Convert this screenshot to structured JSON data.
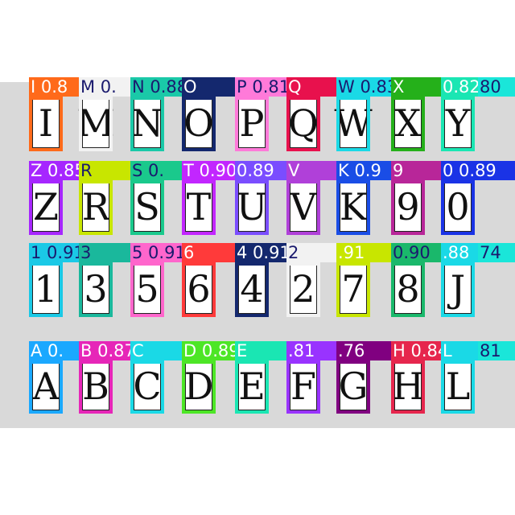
{
  "detections": [
    {
      "char": "I",
      "label": "I 0.8",
      "color": "#ff6a1a",
      "text_color": "#ffffff"
    },
    {
      "char": "M",
      "label": "M 0.",
      "color": "#f2f2f2",
      "text_color": "#1a1a6e"
    },
    {
      "char": "N",
      "label": "N 0.88",
      "color": "#1ac9a8",
      "text_color": "#1a1a6e"
    },
    {
      "char": "O",
      "label": "O",
      "color": "#14286e",
      "text_color": "#ffffff"
    },
    {
      "char": "P",
      "label": "P 0.81",
      "color": "#ff7ad9",
      "text_color": "#1a1a6e"
    },
    {
      "char": "Q",
      "label": "Q",
      "color": "#e8114d",
      "text_color": "#ffffff"
    },
    {
      "char": "W",
      "label": "W 0.83",
      "color": "#1ad9e6",
      "text_color": "#1a1a6e"
    },
    {
      "char": "X",
      "label": "X",
      "color": "#25b01a",
      "text_color": "#ffffff"
    },
    {
      "char": "Y",
      "label": "0.82",
      "color": "#1ae6b3",
      "text_color": "#ffffff"
    },
    {
      "char": "",
      "label": "80",
      "color": "#1ae6d9",
      "text_color": "#1a1a6e"
    },
    {
      "char": "Z",
      "label": "Z 0.85",
      "color": "#a626ff",
      "text_color": "#ffffff"
    },
    {
      "char": "R",
      "label": "R",
      "color": "#c8e600",
      "text_color": "#1a1a6e"
    },
    {
      "char": "S",
      "label": "S 0.",
      "color": "#1ac98c",
      "text_color": "#1a1a6e"
    },
    {
      "char": "T",
      "label": "T 0.90",
      "color": "#c226ff",
      "text_color": "#ffffff"
    },
    {
      "char": "U",
      "label": "0.89",
      "color": "#7a4dff",
      "text_color": "#ffffff"
    },
    {
      "char": "V",
      "label": "V",
      "color": "#b040d9",
      "text_color": "#ffffff"
    },
    {
      "char": "K",
      "label": "K 0.9",
      "color": "#1a4de6",
      "text_color": "#ffffff"
    },
    {
      "char": "9",
      "label": "9",
      "color": "#b82699",
      "text_color": "#ffffff"
    },
    {
      "char": "0",
      "label": "0 0.89",
      "color": "#1a33e6",
      "text_color": "#ffffff"
    },
    {
      "char": "1",
      "label": "1 0.91",
      "color": "#1ac9e6",
      "text_color": "#1a1a6e"
    },
    {
      "char": "3",
      "label": "3",
      "color": "#1ab89c",
      "text_color": "#1a1a6e"
    },
    {
      "char": "5",
      "label": "5 0.91",
      "color": "#ff66cc",
      "text_color": "#1a1a6e"
    },
    {
      "char": "6",
      "label": "6",
      "color": "#ff3a3a",
      "text_color": "#ffffff"
    },
    {
      "char": "4",
      "label": "4 0.91",
      "color": "#14286e",
      "text_color": "#ffffff"
    },
    {
      "char": "2",
      "label": "2",
      "color": "#f2f2f2",
      "text_color": "#1a1a6e"
    },
    {
      "char": "7",
      "label": ".91",
      "color": "#c8e600",
      "text_color": "#ffffff"
    },
    {
      "char": "8",
      "label": "0.90",
      "color": "#1ab86b",
      "text_color": "#1a1a6e"
    },
    {
      "char": "J",
      "label": ".88",
      "color": "#1ad9e6",
      "text_color": "#ffffff"
    },
    {
      "char": "",
      "label": "74",
      "color": "#1ae6d9",
      "text_color": "#1a1a6e"
    },
    {
      "char": "A",
      "label": "A 0.",
      "color": "#1aa8ff",
      "text_color": "#ffffff"
    },
    {
      "char": "B",
      "label": "B 0.87",
      "color": "#e626b8",
      "text_color": "#ffffff"
    },
    {
      "char": "C",
      "label": "C",
      "color": "#1ad9e6",
      "text_color": "#ffffff"
    },
    {
      "char": "D",
      "label": "D 0.89",
      "color": "#4de626",
      "text_color": "#ffffff"
    },
    {
      "char": "E",
      "label": "E",
      "color": "#1ae6b3",
      "text_color": "#ffffff"
    },
    {
      "char": "F",
      "label": ".81",
      "color": "#9933ff",
      "text_color": "#ffffff"
    },
    {
      "char": "G",
      "label": ".76",
      "color": "#800080",
      "text_color": "#ffffff"
    },
    {
      "char": "H",
      "label": "H 0.84",
      "color": "#e6264d",
      "text_color": "#ffffff"
    },
    {
      "char": "L",
      "label": "L",
      "color": "#1ad9e6",
      "text_color": "#ffffff"
    },
    {
      "char": "",
      "label": "81",
      "color": "#1ae6d9",
      "text_color": "#1a1a6e"
    }
  ]
}
